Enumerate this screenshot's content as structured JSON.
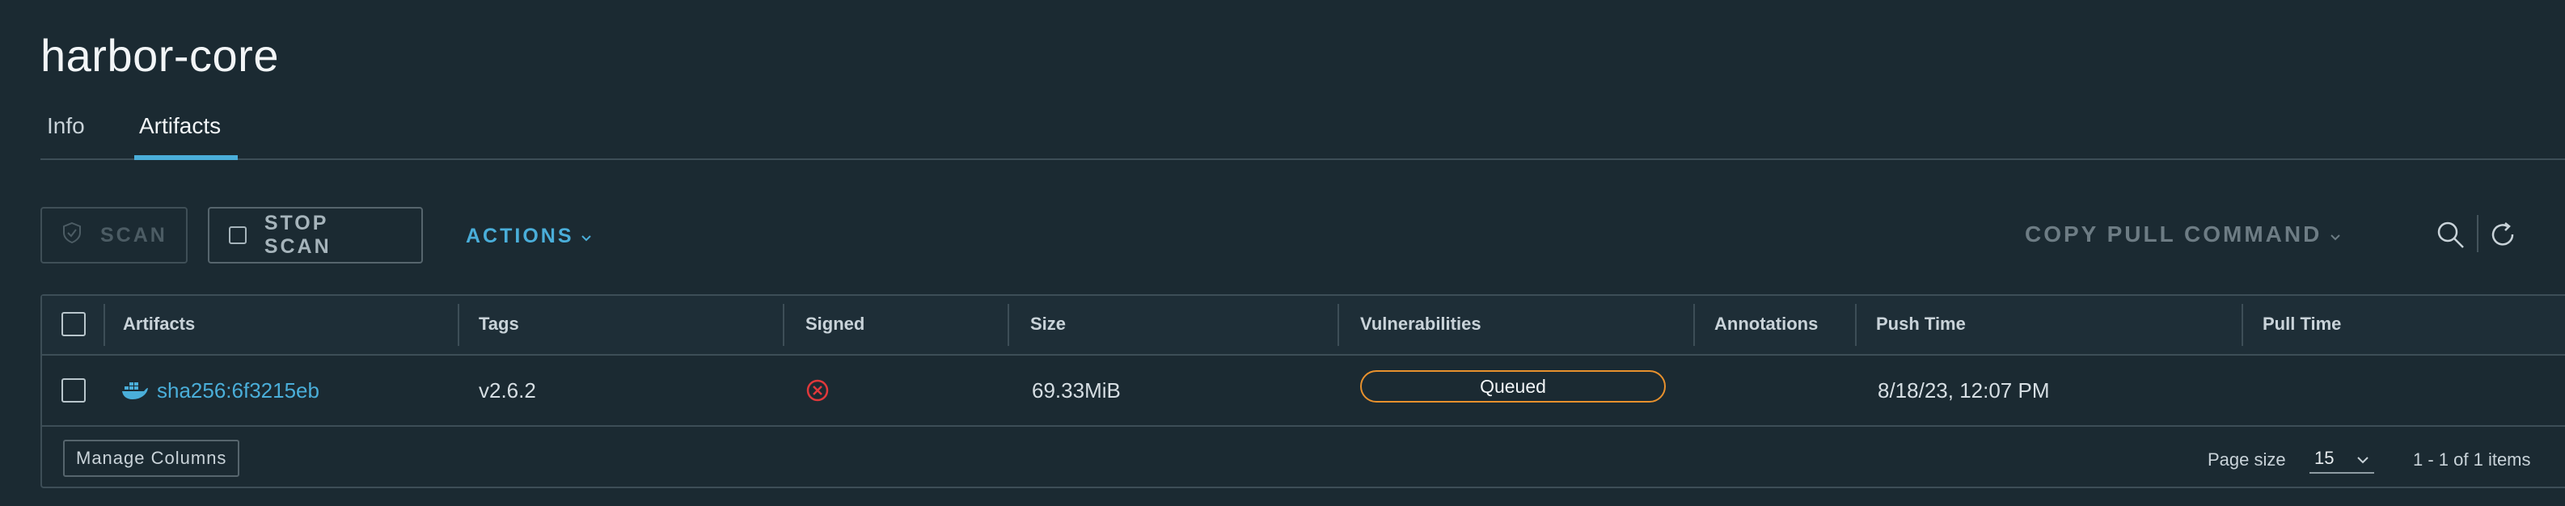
{
  "repository": {
    "title": "harbor-core"
  },
  "tabs": [
    {
      "label": "Info",
      "active": false
    },
    {
      "label": "Artifacts",
      "active": true
    }
  ],
  "toolbar": {
    "scan_label": "SCAN",
    "stop_scan_label": "STOP SCAN",
    "actions_label": "ACTIONS",
    "copy_pull_command_label": "COPY PULL COMMAND",
    "search_icon": "search-icon",
    "refresh_icon": "refresh-icon"
  },
  "table": {
    "columns": [
      "Artifacts",
      "Tags",
      "Signed",
      "Size",
      "Vulnerabilities",
      "Annotations",
      "Push Time",
      "Pull Time"
    ],
    "rows": [
      {
        "artifact": "sha256:6f3215eb",
        "artifact_icon": "docker-icon",
        "tag": "v2.6.2",
        "signed_icon": "not-signed-icon",
        "size": "69.33MiB",
        "vulnerabilities": "Queued",
        "annotations": "",
        "push_time": "8/18/23, 12:07 PM",
        "pull_time": ""
      }
    ]
  },
  "footer": {
    "manage_columns_label": "Manage Columns",
    "page_size_label": "Page size",
    "page_size_value": "15",
    "pagination_info": "1 - 1 of 1 items"
  },
  "colors": {
    "background": "#1b2a32",
    "accent": "#4aaed9",
    "queued_border": "#e8912d",
    "error_red": "#e0383b"
  }
}
